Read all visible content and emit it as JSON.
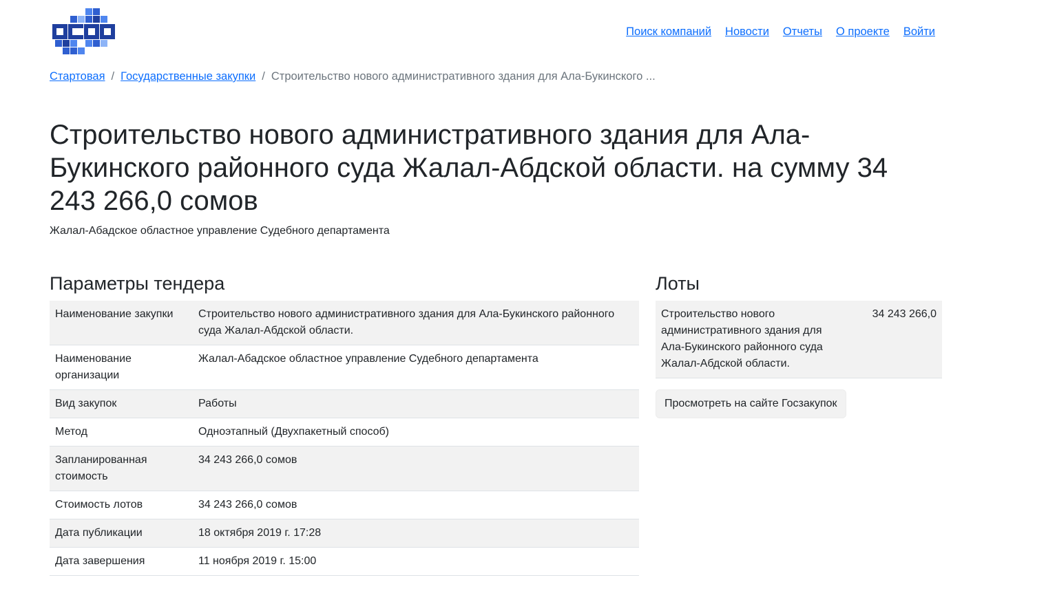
{
  "nav": {
    "links": [
      "Поиск компаний",
      "Новости",
      "Отчеты",
      "О проекте",
      "Войти"
    ]
  },
  "breadcrumb": {
    "home": "Стартовая",
    "section": "Государственные закупки",
    "current": "Строительство нового административного здания для Ала-Букинского ..."
  },
  "page": {
    "title": "Строительство нового административного здания для Ала-Букинского районного суда Жалал-Абдской области. на сумму 34 243 266,0 сомов",
    "subtitle": "Жалал-Абадское областное управление Судебного департамента"
  },
  "params": {
    "heading": "Параметры тендера",
    "rows": [
      {
        "key": "Наименование закупки",
        "value": "Строительство нового административного здания для Ала-Букинского районного суда Жалал-Абдской области."
      },
      {
        "key": "Наименование организации",
        "value": "Жалал-Абадское областное управление Судебного департамента"
      },
      {
        "key": "Вид закупок",
        "value": "Работы"
      },
      {
        "key": "Метод",
        "value": "Одноэтапный (Двухпакетный способ)"
      },
      {
        "key": "Запланированная стоимость",
        "value": "34 243 266,0 сомов"
      },
      {
        "key": "Стоимость лотов",
        "value": "34 243 266,0 сомов"
      },
      {
        "key": "Дата публикации",
        "value": "18 октября 2019 г. 17:28"
      },
      {
        "key": "Дата завершения",
        "value": "11 ноября 2019 г. 15:00"
      }
    ]
  },
  "lots": {
    "heading": "Лоты",
    "items": [
      {
        "name": "Строительство нового административного здания для Ала-Букинского районного суда Жалал-Абдской области.",
        "amount": "34 243 266,0"
      }
    ],
    "button_label": "Просмотреть на сайте Госзакупок"
  },
  "colors": {
    "link": "#0d6efd",
    "logo_dark": "#1f3f9e",
    "logo_mid": "#2f5fd0",
    "logo_light": "#4f86ef",
    "logo_lighter": "#8db4f7",
    "striped_row": "#f2f2f2"
  }
}
